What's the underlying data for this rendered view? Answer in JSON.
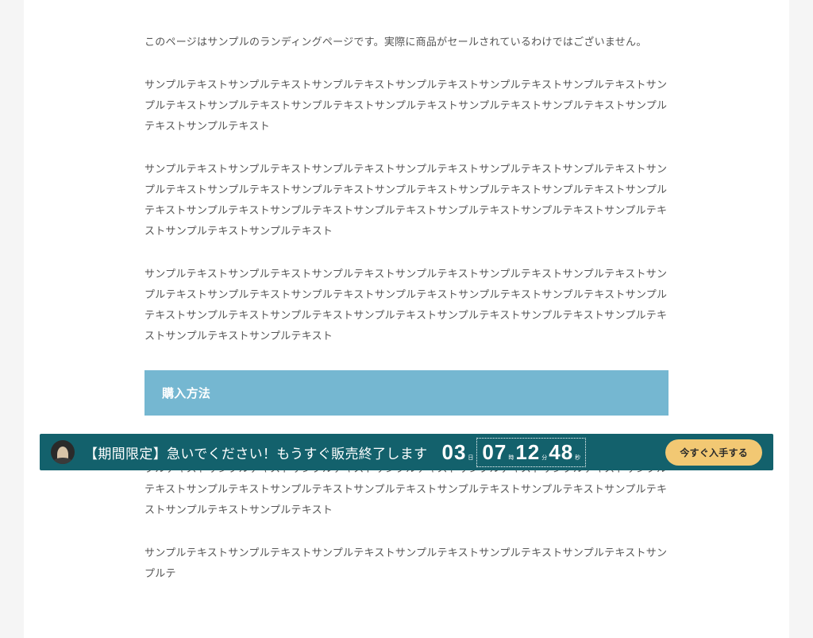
{
  "content": {
    "notice": "このページはサンプルのランディングページです。実際に商品がセールされているわけではございません。",
    "paragraph1": "サンプルテキストサンプルテキストサンプルテキストサンプルテキストサンプルテキストサンプルテキストサンプルテキストサンプルテキストサンプルテキストサンプルテキストサンプルテキストサンプルテキストサンプルテキストサンプルテキスト",
    "paragraph2": "サンプルテキストサンプルテキストサンプルテキストサンプルテキストサンプルテキストサンプルテキストサンプルテキストサンプルテキストサンプルテキストサンプルテキストサンプルテキストサンプルテキストサンプルテキストサンプルテキストサンプルテキストサンプルテキストサンプルテキストサンプルテキストサンプルテキストサンプルテキストサンプルテキスト",
    "paragraph3": "サンプルテキストサンプルテキストサンプルテキストサンプルテキストサンプルテキストサンプルテキストサンプルテキストサンプルテキストサンプルテキストサンプルテキストサンプルテキストサンプルテキストサンプルテキストサンプルテキストサンプルテキストサンプルテキストサンプルテキストサンプルテキストサンプルテキストサンプルテキストサンプルテキスト",
    "section_heading": "購入方法",
    "paragraph4": "サンプルテキストサンプルテキストサンプルテキストサンプルテキストサンプルテキストサンプルテキストサンプルテキストサンプルテキストサンプルテキストサンプルテキストサンプルテキストサンプルテキストサンプルテキストサンプルテキストサンプルテキストサンプルテキストサンプルテキストサンプルテキストサンプルテキストサンプルテキストサンプルテキスト",
    "paragraph5_partial": "サンプルテキストサンプルテキストサンプルテキストサンプルテキストサンプルテキストサンプルテキストサンプルテ"
  },
  "bar": {
    "message": "【期間限定】急いでください！もうすぐ販売終了します",
    "countdown": {
      "days": "03",
      "days_unit": "日",
      "hours": "07",
      "hours_unit": "時",
      "minutes": "12",
      "minutes_unit": "分",
      "seconds": "48",
      "seconds_unit": "秒"
    },
    "cta_label": "今すぐ入手する"
  }
}
